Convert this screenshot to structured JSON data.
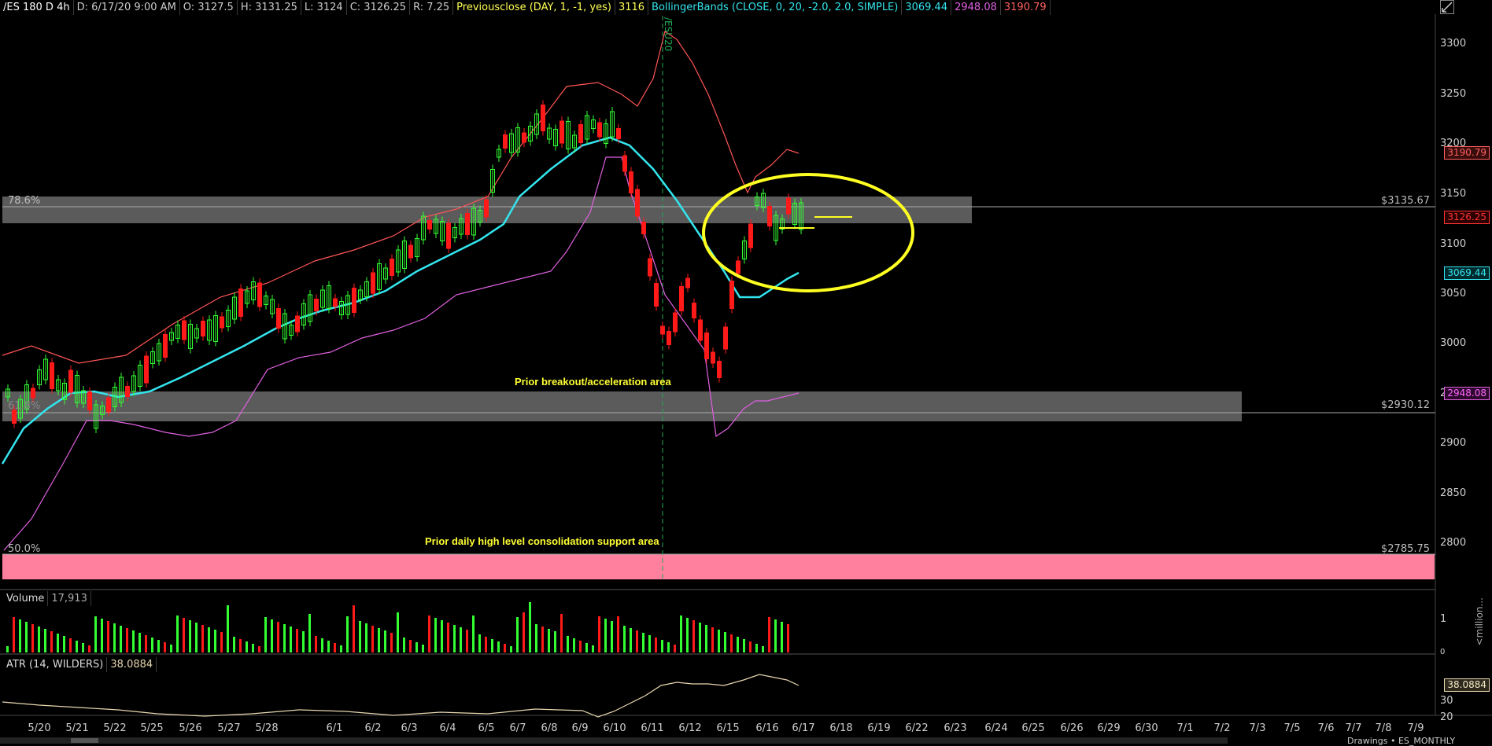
{
  "header": {
    "symbol": "/ES 180 D 4h",
    "datetime": "D: 6/17/20 9:00 AM",
    "open": "O: 3127.5",
    "high": "H: 3131.25",
    "low": "L: 3124",
    "close": "C: 3126.25",
    "range": "R: 7.25",
    "prevclose_label": "Previousclose (DAY, 1, -1, yes)",
    "prevclose_value": "3116",
    "bb_label": "BollingerBands (CLOSE, 0, 20, -2.0, 2.0, SIMPLE)",
    "bb_mid": "3069.44",
    "bb_lower": "2948.08",
    "bb_upper": "3190.79"
  },
  "colors": {
    "up": "#33ff33",
    "down": "#ff1a1a",
    "mid_band": "#33e5ee",
    "lower_band": "#e060e0",
    "upper_band": "#ff6060",
    "annotation": "#ffff33",
    "zone_gray": "#7a7a7a",
    "zone_pink": "#ff7f9f"
  },
  "price_axis": {
    "ticks": [
      "3300",
      "3250",
      "3200",
      "3150",
      "3100",
      "3050",
      "3000",
      "2950",
      "2900",
      "2850",
      "2800"
    ],
    "tags": {
      "upper": "3190.79",
      "last": "3126.25",
      "mid": "3069.44",
      "lower": "2948.08"
    }
  },
  "levels": {
    "fib786_label": "78.6%",
    "fib786_value": "$3135.67",
    "fib618_label": "61.8%",
    "fib618_value": "$2930.12",
    "fib50_label": "50.0%",
    "fib50_value": "$2785.75"
  },
  "annotations": {
    "breakout": "Prior breakout/acceleration area",
    "consolidation": "Prior daily high level consolidation support area",
    "contract_roll": "/ESU20"
  },
  "volume": {
    "label": "Volume",
    "value": "17,913",
    "axis_top": "1",
    "axis_bottom": "0",
    "unit": "<million..."
  },
  "atr": {
    "label": "ATR (14, WILDERS)",
    "value": "38.0884",
    "tag": "38.0884",
    "ticks": [
      "30",
      "20"
    ]
  },
  "date_axis": [
    "5/20",
    "5/21",
    "5/22",
    "5/25",
    "5/26",
    "5/27",
    "5/28",
    "6/1",
    "6/2",
    "6/3",
    "6/4",
    "6/5",
    "6/7",
    "6/8",
    "6/9",
    "6/10",
    "6/11",
    "6/12",
    "6/15",
    "6/16",
    "6/17",
    "6/18",
    "6/19",
    "6/22",
    "6/23",
    "6/24",
    "6/25",
    "6/26",
    "6/29",
    "6/30",
    "7/1",
    "7/2",
    "7/3",
    "7/5",
    "7/6",
    "7/7",
    "7/8",
    "7/9"
  ],
  "footer_text": "Drawings • ES_MONTHLY"
}
